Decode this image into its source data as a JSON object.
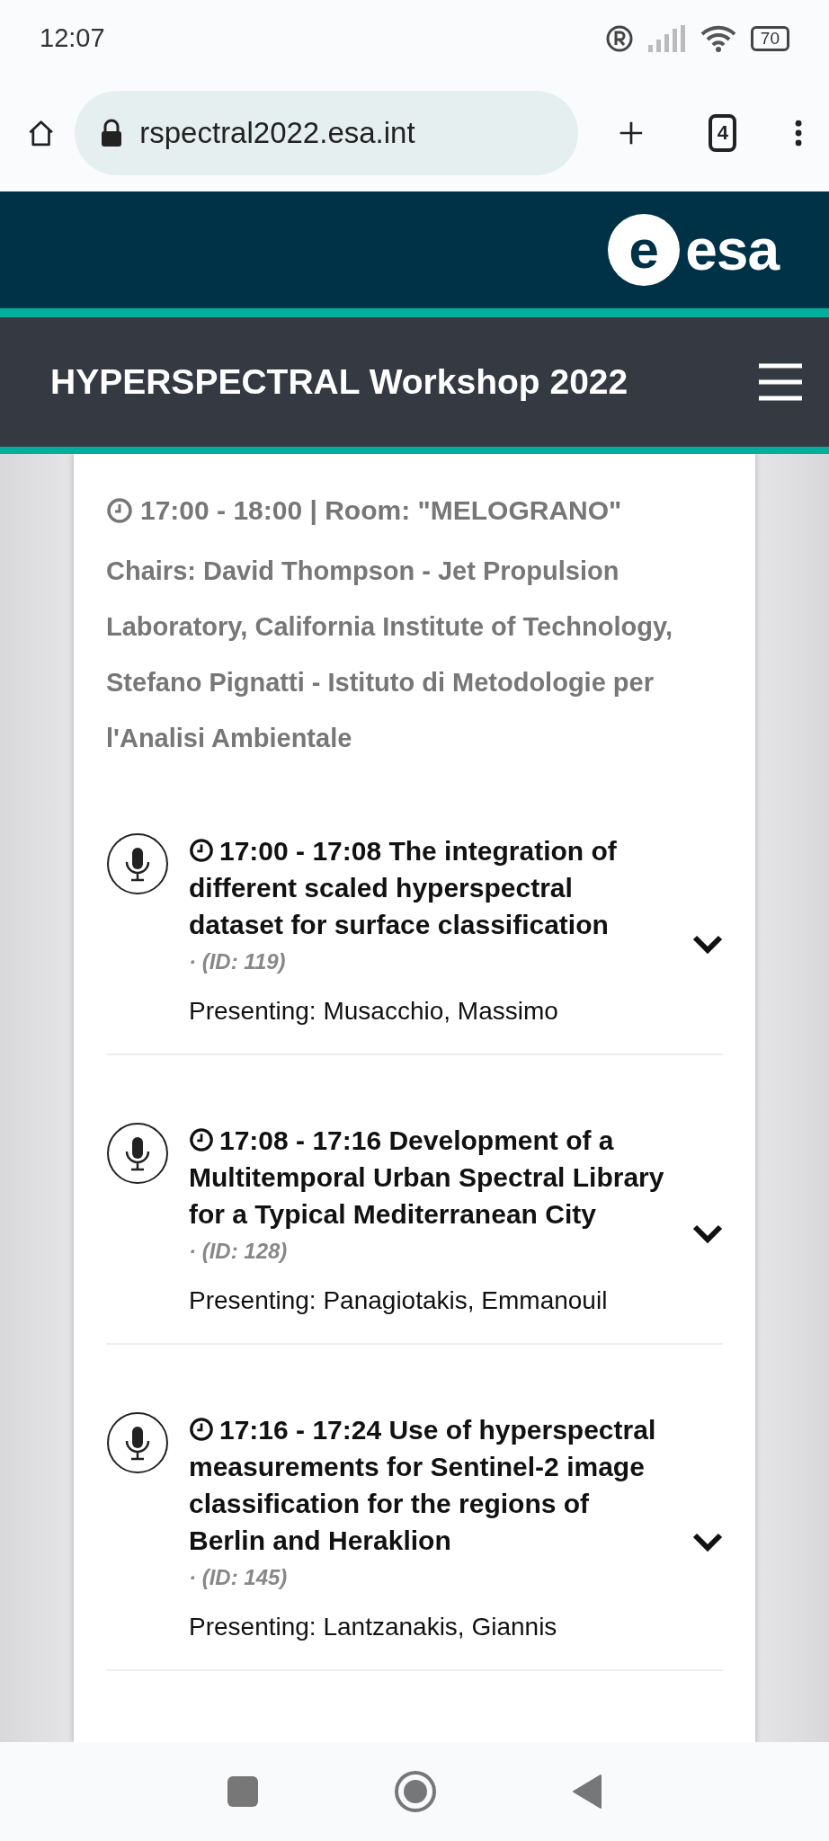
{
  "status_bar": {
    "time": "12:07",
    "battery": "70"
  },
  "browser": {
    "url": "rspectral2022.esa.int",
    "tab_count": "4"
  },
  "site": {
    "logo_mark": "e",
    "logo": "esa",
    "title": "HYPERSPECTRAL Workshop 2022"
  },
  "session": {
    "time_room": "17:00 - 18:00 | Room: \"MELOGRANO\"",
    "chairs": "Chairs: David Thompson - Jet Propulsion Laboratory, California Institute of Technology, Stefano Pignatti - Istituto di Metodologie per l'Analisi Ambientale"
  },
  "talks": [
    {
      "time": "17:00 - 17:08",
      "title": "The integration of different scaled hyperspectral dataset for surface classification",
      "id": "· (ID: 119)",
      "presenter": "Presenting: Musacchio, Massimo",
      "expanded": false
    },
    {
      "time": "17:08 - 17:16",
      "title": "Development of a Multitemporal Urban Spectral Library for a Typical Mediterranean City",
      "id": "· (ID: 128)",
      "presenter": "Presenting: Panagiotakis, Emmanouil",
      "expanded": false
    },
    {
      "time": "17:16 - 17:24",
      "title": "Use of hyperspectral measurements for Sentinel-2 image classification for the regions of Berlin and Heraklion",
      "id": "· (ID: 145)",
      "presenter": "Presenting: Lantzanakis, Giannis",
      "expanded": false
    }
  ]
}
